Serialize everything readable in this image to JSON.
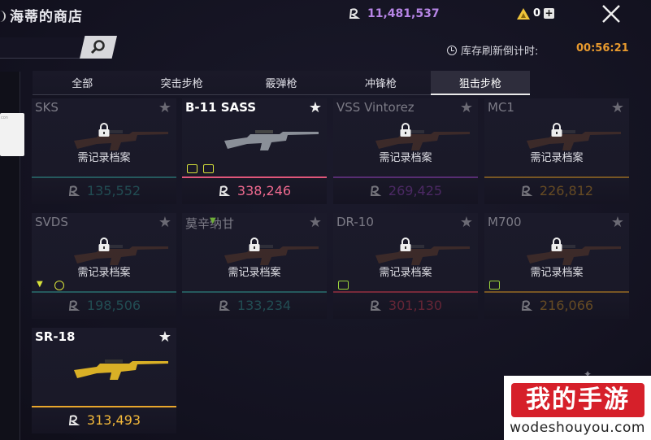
{
  "header": {
    "title": "海蒂的商店",
    "currency_value": "11,481,537",
    "gold_value": "0",
    "refresh_label": "库存刷新倒计时:",
    "refresh_time": "00:56:21"
  },
  "tabs": [
    {
      "label": "全部",
      "active": false
    },
    {
      "label": "突击步枪",
      "active": false
    },
    {
      "label": "霰弹枪",
      "active": false
    },
    {
      "label": "冲锋枪",
      "active": false
    },
    {
      "label": "狙击步枪",
      "active": true
    }
  ],
  "items": [
    {
      "name": "SKS",
      "locked": true,
      "requirement": "需记录档案",
      "price": "135,552",
      "accent": "#2f8f8b"
    },
    {
      "name": "B-11 SASS",
      "locked": false,
      "requirement": "",
      "price": "338,246",
      "accent": "#e0567a"
    },
    {
      "name": "VSS Vintorez",
      "locked": true,
      "requirement": "需记录档案",
      "price": "269,425",
      "accent": "#8a3fb0"
    },
    {
      "name": "MC1",
      "locked": true,
      "requirement": "需记录档案",
      "price": "226,812",
      "accent": "#c58a22"
    },
    {
      "name": "SVDS",
      "locked": true,
      "requirement": "需记录档案",
      "price": "198,506",
      "accent": "#2f8f8b"
    },
    {
      "name": "莫辛纳甘",
      "locked": true,
      "requirement": "需记录档案",
      "price": "133,234",
      "accent": "#2f8f8b"
    },
    {
      "name": "DR-10",
      "locked": true,
      "requirement": "需记录档案",
      "price": "301,130",
      "accent": "#c2384a"
    },
    {
      "name": "M700",
      "locked": true,
      "requirement": "需记录档案",
      "price": "216,066",
      "accent": "#c58a22"
    },
    {
      "name": "SR-18",
      "locked": false,
      "requirement": "",
      "price": "313,493",
      "accent": "#e8a62c"
    }
  ],
  "watermark": {
    "logo_text": "我的手游",
    "url": "wodeshouyou.com"
  },
  "popup_text": "con",
  "colors": {
    "currency": "#b785e6",
    "refresh_time": "#e89a2e",
    "teal": "#2f8f8b",
    "pink": "#e0567a",
    "purple": "#8a3fb0",
    "gold": "#c58a22",
    "red": "#c2384a"
  },
  "icons": [
    "close-icon",
    "search-icon",
    "clock-icon",
    "coin-icon",
    "gold-triangle-icon",
    "plus-icon",
    "lock-icon",
    "star-icon"
  ]
}
